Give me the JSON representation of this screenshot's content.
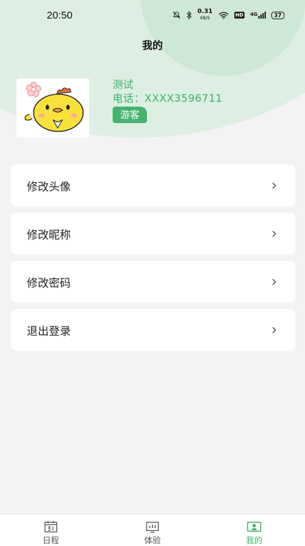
{
  "status_bar": {
    "time": "20:50",
    "net_speed": "0.31",
    "net_unit": "KB/S",
    "hd": "HD",
    "signal": "4G",
    "battery": "37"
  },
  "header": {
    "title": "我的"
  },
  "profile": {
    "name": "测试",
    "phone": "电话：XXXX3596711",
    "badge": "游客"
  },
  "menu": {
    "items": [
      {
        "label": "修改头像"
      },
      {
        "label": "修改昵称"
      },
      {
        "label": "修改密码"
      },
      {
        "label": "退出登录"
      }
    ]
  },
  "tabbar": {
    "tabs": [
      {
        "label": "日程",
        "icon": "calendar-icon"
      },
      {
        "label": "体验",
        "icon": "chart-icon"
      },
      {
        "label": "我的",
        "icon": "profile-icon"
      }
    ],
    "active_index": 2
  },
  "colors": {
    "accent": "#3cb068",
    "background": "#f3f3f3",
    "header_bg": "#ddeee2"
  }
}
